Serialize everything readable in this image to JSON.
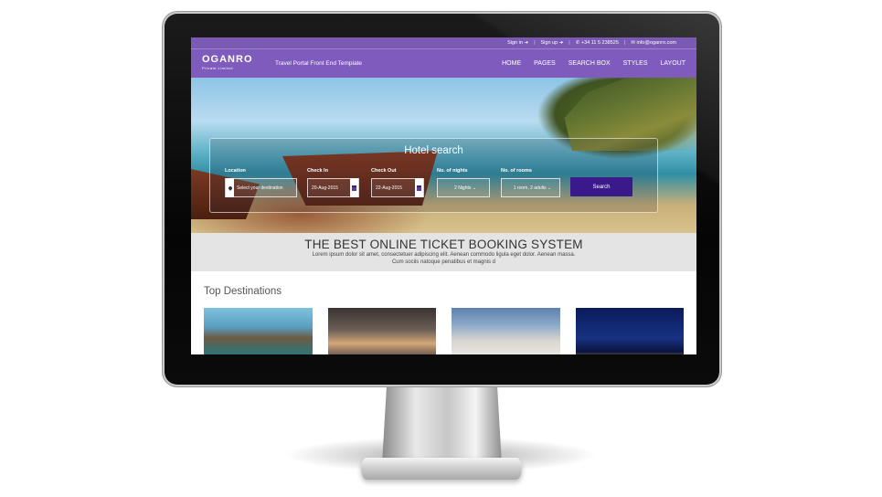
{
  "topbar": {
    "signin": "Sign in",
    "signup": "Sign up",
    "phone": "+34 11 5 238525",
    "email": "info@oganro.com"
  },
  "navbar": {
    "logo": "OGANRO",
    "logo_sub": "Private Limited",
    "tagline": "Travel Portal Front End Template",
    "menu": [
      "HOME",
      "PAGES",
      "SEARCH BOX",
      "STYLES",
      "LAYOUT"
    ]
  },
  "search": {
    "title": "Hotel search",
    "location_label": "Location",
    "location_placeholder": "Select your destination",
    "checkin_label": "Check In",
    "checkin_value": "20-Aug-2015",
    "checkout_label": "Check Out",
    "checkout_value": "22-Aug-2015",
    "nights_label": "No. of nights",
    "nights_value": "2 Nights",
    "rooms_label": "No. of rooms",
    "rooms_value": "1 room, 2 adults",
    "button": "Search"
  },
  "banner": {
    "title": "THE BEST ONLINE TICKET BOOKING SYSTEM",
    "line1": "Lorem ipsum dolor sit amet, consectetuer adipiscing elit. Aenean commodo ligula eget dolor. Aenean massa.",
    "line2": "Cum sociis natoque penatibus et magnis d"
  },
  "destinations": {
    "title": "Top Destinations"
  },
  "colors": {
    "brand": "#7e5bbd",
    "search_button": "#3a1a8a"
  }
}
